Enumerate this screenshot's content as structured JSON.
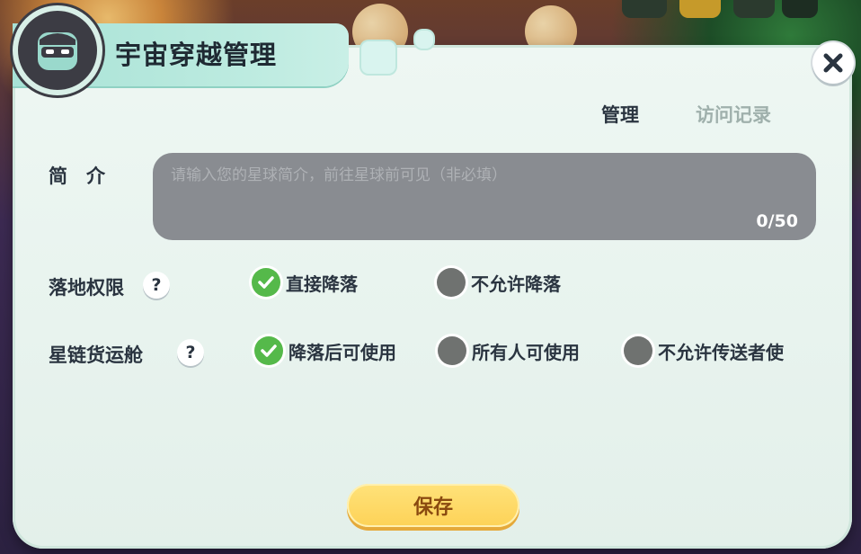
{
  "dialog": {
    "title": "宇宙穿越管理",
    "close_icon": "close-icon"
  },
  "tabs": [
    {
      "label": "管理",
      "active": true
    },
    {
      "label": "访问记录",
      "active": false
    }
  ],
  "intro": {
    "label": "简　介",
    "placeholder": "请输入您的星球简介，前往星球前可见（非必填）",
    "value": "",
    "counter": "0/50"
  },
  "landing": {
    "label": "落地权限",
    "help": "?",
    "options": [
      {
        "label": "直接降落",
        "checked": true
      },
      {
        "label": "不允许降落",
        "checked": false
      }
    ]
  },
  "cargo": {
    "label": "星链货运舱",
    "help": "?",
    "options": [
      {
        "label": "降落后可使用",
        "checked": true
      },
      {
        "label": "所有人可使用",
        "checked": false
      },
      {
        "label": "不允许传送者使",
        "checked": false
      }
    ]
  },
  "save_button": "保存",
  "colors": {
    "accent_green": "#55b94a",
    "save_yellow": "#fdd257",
    "panel_bg": "#e3f0ea",
    "title_tab": "#a8e2d6"
  }
}
